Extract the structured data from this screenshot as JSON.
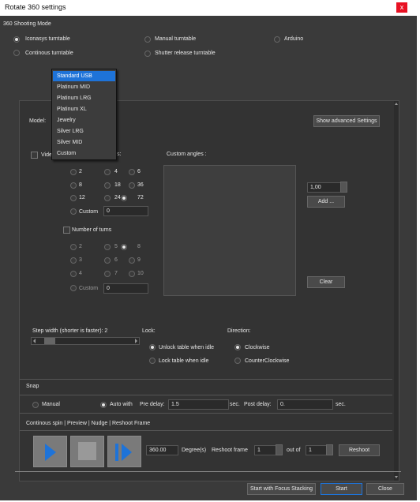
{
  "window": {
    "title": "Rotate 360 settings",
    "close_label": "x"
  },
  "mode": {
    "label": "360 Shooting Mode",
    "options": [
      "Iconasys turntable",
      "Continous turntable",
      "Manual turntable",
      "Shutter release turntable",
      "Arduino"
    ]
  },
  "model": {
    "label": "Model:",
    "dropdown_items": [
      "Standard USB",
      "Platinum MID",
      "Platinum LRG",
      "Platinum XL",
      "Jewelry",
      "Silver LRG",
      "Silver MID",
      "Custom"
    ],
    "selected": "Standard USB"
  },
  "advanced_button": "Show advanced Settings",
  "video_label": "Vide",
  "frames": {
    "fragment": "s:",
    "row1": [
      "2",
      "4",
      "6"
    ],
    "row2": [
      "8",
      "18",
      "36"
    ],
    "row3": [
      "12",
      "24",
      "72"
    ],
    "custom_label": "Custom",
    "custom_value": "0"
  },
  "custom_angles": {
    "label": "Custom angles :",
    "value": "1,00",
    "add_label": "Add ...",
    "clear_label": "Clear"
  },
  "turns": {
    "label": "Number of turns",
    "row1": [
      "2",
      "5",
      "8"
    ],
    "row2": [
      "3",
      "6",
      "9"
    ],
    "row3": [
      "4",
      "7",
      "10"
    ],
    "custom_label": "Custom",
    "custom_value": "0"
  },
  "step": {
    "label": "Step width (shorter is faster): 2"
  },
  "lock": {
    "label": "Lock:",
    "options": [
      "Unlock table when idle",
      "Lock table when idle"
    ]
  },
  "direction": {
    "label": "Direction:",
    "options": [
      "Clockwise",
      "CounterClockwise"
    ]
  },
  "snap": {
    "label": "Snap",
    "manual": "Manual",
    "auto": "Auto with",
    "pre_delay_label": "Pre delay:",
    "pre_delay": "1.5",
    "sec1": "sec.",
    "post_delay_label": "Post delay:",
    "post_delay": "0.",
    "sec2": "sec."
  },
  "spin": {
    "label": "Continous spin | Preview | Nudge | Reshoot Frame",
    "degrees_value": "360.00",
    "degrees_label": "Degree(s)",
    "reshoot_label": "Reshoot frame",
    "reshoot_value": "1",
    "out_of_label": "out of",
    "out_of_value": "1",
    "reshoot_button": "Reshoot"
  },
  "footer": {
    "focus_button": "Start with Focus Stacking",
    "start_button": "Start",
    "close_button": "Close"
  },
  "colors": {
    "background": "#3a3a3a",
    "accent": "#1e73d8",
    "close": "#e81123"
  }
}
